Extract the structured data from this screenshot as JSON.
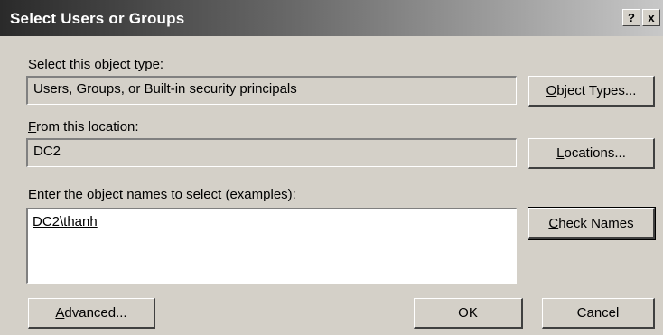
{
  "window": {
    "title": "Select Users or Groups",
    "help_glyph": "?",
    "close_glyph": "x"
  },
  "object_type": {
    "label_key": "S",
    "label_rest": "elect this object type:",
    "value": "Users, Groups, or Built-in security principals",
    "button_key": "O",
    "button_rest": "bject Types..."
  },
  "location": {
    "label_key": "F",
    "label_rest": "rom this location:",
    "value": "DC2",
    "button_key": "L",
    "button_rest": "ocations..."
  },
  "names": {
    "label_key": "E",
    "label_pre": "nter the object names to select (",
    "label_link": "examples",
    "label_post": "):",
    "value": "DC2\\thanh",
    "button_key": "C",
    "button_rest": "heck Names"
  },
  "footer": {
    "advanced_key": "A",
    "advanced_rest": "dvanced...",
    "ok": "OK",
    "cancel": "Cancel"
  },
  "colors": {
    "face": "#d4d0c8",
    "titlebar_start": "#2a2a2a",
    "titlebar_end": "#c8c8c8"
  }
}
